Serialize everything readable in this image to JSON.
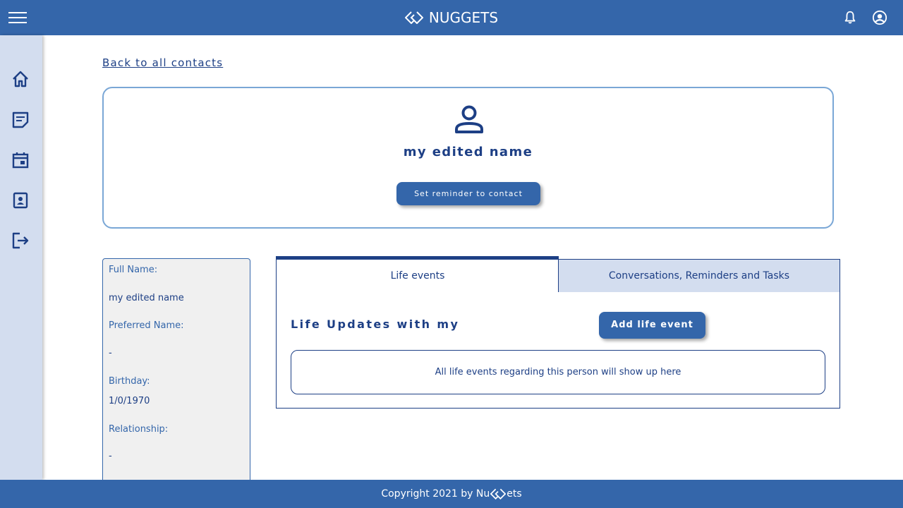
{
  "header": {
    "brand_name": "NUGGETS",
    "menu_icon": "hamburger-menu-icon",
    "notification_icon": "bell-icon",
    "account_icon": "account-circle-icon",
    "background_color": "#3466aa"
  },
  "sidebar": {
    "items": [
      {
        "icon": "home-icon"
      },
      {
        "icon": "notes-icon"
      },
      {
        "icon": "calendar-icon"
      },
      {
        "icon": "contacts-icon"
      },
      {
        "icon": "logout-icon"
      }
    ]
  },
  "navigation": {
    "back_link": "Back to all contacts"
  },
  "profile": {
    "icon": "person-icon",
    "name": "my edited name",
    "reminder_button": "Set reminder to contact"
  },
  "details": {
    "full_name_label": "Full Name:",
    "full_name_value": "my edited name",
    "preferred_name_label": "Preferred Name:",
    "preferred_name_value": "-",
    "birthday_label": "Birthday:",
    "birthday_value": "1/0/1970",
    "relationship_label": "Relationship:",
    "relationship_value": "-"
  },
  "tabs": [
    {
      "label": "Life events",
      "active": true
    },
    {
      "label": "Conversations, Reminders and Tasks",
      "active": false
    }
  ],
  "life_events": {
    "title": "Life Updates with my",
    "add_button": "Add life event",
    "empty_message": "All life events regarding this person will show up here"
  },
  "footer": {
    "text_before": "Copyright 2021 by Nu",
    "text_after": "ets"
  },
  "colors": {
    "primary": "#3466aa",
    "dark_text": "#1d3f85",
    "sidebar_bg": "#d3ddef",
    "card_border": "#7aa7d6",
    "details_bg": "#f0f0f0"
  }
}
